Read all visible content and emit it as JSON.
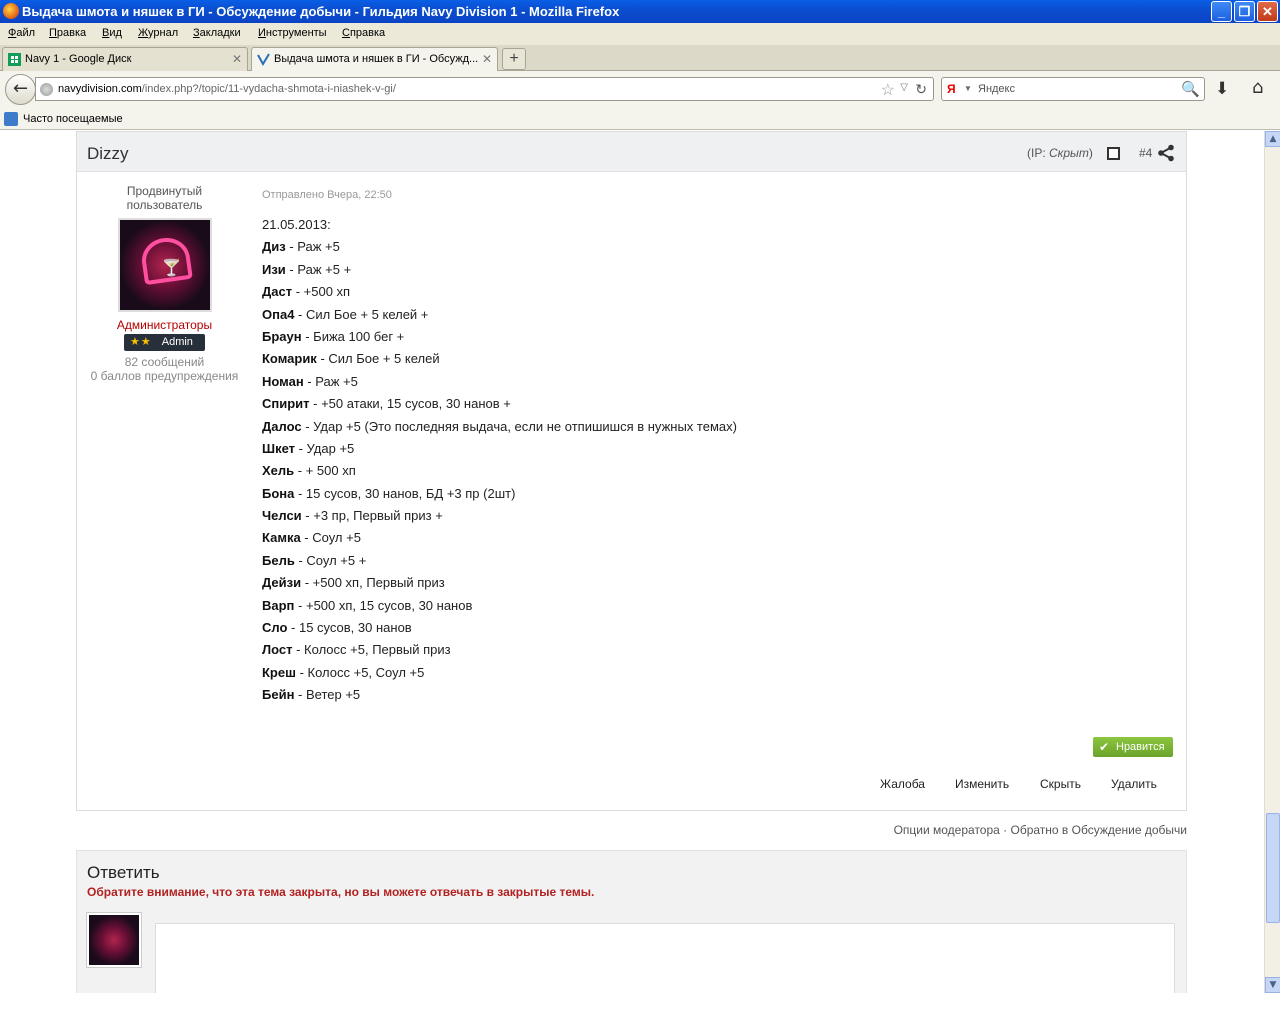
{
  "window": {
    "title": "Выдача шмота и няшек в ГИ - Обсуждение добычи - Гильдия Navy Division 1 - Mozilla Firefox",
    "minimize": "_",
    "maximize": "❐",
    "close": "✕"
  },
  "menu": [
    "Файл",
    "Правка",
    "Вид",
    "Журнал",
    "Закладки",
    "Инструменты",
    "Справка"
  ],
  "tabs": [
    {
      "label": "Navy 1 - Google Диск",
      "close": "✕"
    },
    {
      "label": "Выдача шмота и няшек в ГИ - Обсужд...",
      "close": "✕"
    }
  ],
  "new_tab": "+",
  "nav": {
    "back": "←",
    "url_host": "navydivision.com",
    "url_path": "/index.php?/topic/11-vydacha-shmota-i-niashek-v-gi/",
    "bookmark_star": "☆",
    "history_dropdown": "▽",
    "reload": "↻",
    "search_engine": "Я",
    "search_dropdown": "▼",
    "search_placeholder": "Яндекс",
    "search_go": "🔍",
    "downloads": "⬇",
    "home": "⌂"
  },
  "bookmarks": {
    "label": "Часто посещаемые"
  },
  "scrollbar": {
    "up": "▲",
    "down": "▼",
    "position": 0.8
  },
  "post": {
    "author": "Dizzy",
    "ip_prefix": "(IP: ",
    "ip_value": "Скрыт",
    "ip_suffix": ")",
    "number": "#4",
    "rank_line1": "Продвинутый",
    "rank_line2": "пользователь",
    "group": "Администраторы",
    "badge_stars": "★★",
    "badge_label": "Admin",
    "post_count": "82 сообщений",
    "warnings": "0 баллов предупреждения",
    "posted": "Отправлено Вчера, 22:50",
    "date_line": "21.05.2013:",
    "entries": [
      {
        "name": "Диз",
        "text": " - Раж +5"
      },
      {
        "name": "Изи",
        "text": " - Раж +5 +"
      },
      {
        "name": "Даст",
        "text": " - +500 хп"
      },
      {
        "name": "Опа4",
        "text": " - Сил Бое + 5 келей +"
      },
      {
        "name": "Браун",
        "text": " - Бижа 100 бег +"
      },
      {
        "name": "Комарик",
        "text": " - Сил Бое + 5 келей"
      },
      {
        "name": "Номан",
        "text": " - Раж +5"
      },
      {
        "name": "Спирит",
        "text": " - +50 атаки, 15 сусов, 30 нанов +"
      },
      {
        "name": "Далос",
        "text": " - Удар +5 (Это последняя выдача, если не отпишишся в нужных темах)"
      },
      {
        "name": "Шкет",
        "text": " - Удар +5"
      },
      {
        "name": "Хель",
        "text": " - + 500 хп"
      },
      {
        "name": "Бона",
        "text": " - 15 сусов, 30 нанов, БД +3 пр (2шт)"
      },
      {
        "name": "Челси",
        "text": " - +3 пр, Первый приз +"
      },
      {
        "name": "Камка",
        "text": " - Соул +5"
      },
      {
        "name": "Бель",
        "text": " - Соул +5 +"
      },
      {
        "name": "Дейзи",
        "text": " - +500 хп, Первый приз"
      },
      {
        "name": "Варп",
        "text": " - +500 хп, 15 сусов, 30 нанов"
      },
      {
        "name": "Сло",
        "text": " - 15 сусов, 30 нанов"
      },
      {
        "name": "Лост",
        "text": " - Колосс +5, Первый приз"
      },
      {
        "name": "Креш",
        "text": " - Колосс +5, Соул +5"
      },
      {
        "name": "Бейн",
        "text": " - Ветер +5"
      }
    ],
    "like_icon": "✔",
    "like_label": "Нравится",
    "actions": [
      "Жалоба",
      "Изменить",
      "Скрыть",
      "Удалить"
    ]
  },
  "moderation_line": "Опции модератора · Обратно в Обсуждение добычи",
  "reply": {
    "title": "Ответить",
    "notice": "Обратите внимание, что эта тема закрыта, но вы можете отвечать в закрытые темы."
  },
  "colors": {
    "titlebar": "#0b4ed0",
    "admin_group": "#b40000",
    "like_button": "#7ab632",
    "notice": "#b22222"
  }
}
